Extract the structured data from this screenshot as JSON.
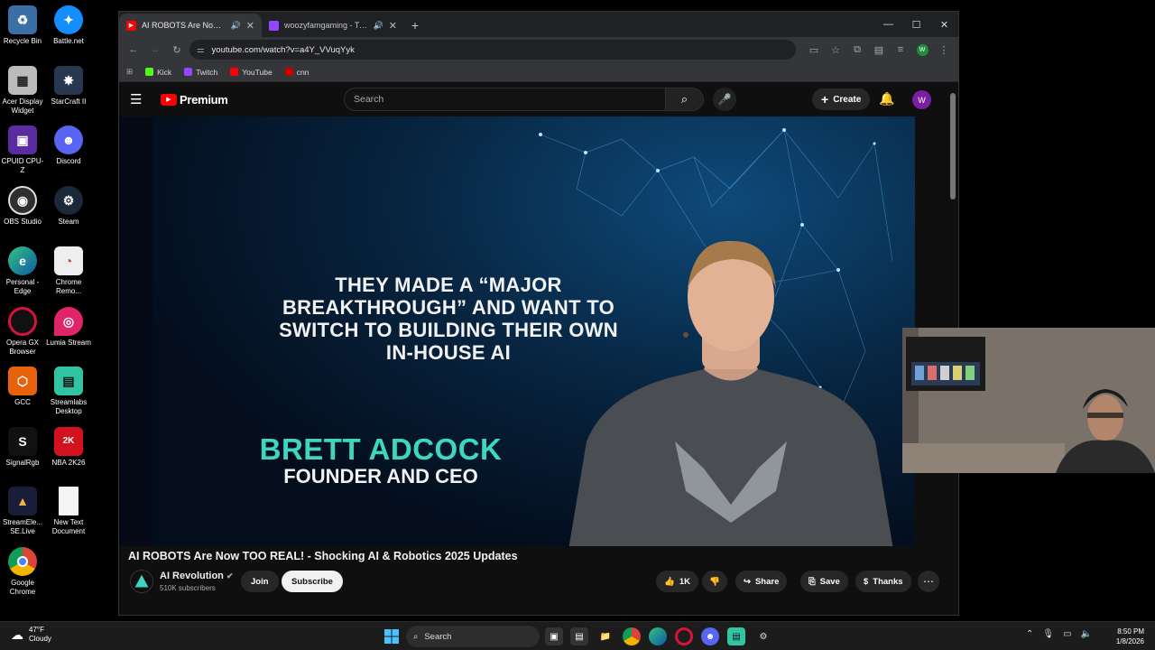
{
  "desktop": {
    "icons": [
      {
        "label": "Recycle Bin"
      },
      {
        "label": "Battle.net"
      },
      {
        "label": "Acer Display Widget"
      },
      {
        "label": "StarCraft II"
      },
      {
        "label": "CPUID CPU-Z"
      },
      {
        "label": "Discord"
      },
      {
        "label": "OBS Studio"
      },
      {
        "label": "Steam"
      },
      {
        "label": "Personal - Edge"
      },
      {
        "label": "Chrome Remo..."
      },
      {
        "label": "Opera GX Browser"
      },
      {
        "label": "Lumia Stream"
      },
      {
        "label": "GCC"
      },
      {
        "label": "Streamlabs Desktop"
      },
      {
        "label": "SignalRgb"
      },
      {
        "label": "NBA 2K26"
      },
      {
        "label": "StreamEle... SE.Live"
      },
      {
        "label": "New Text Document"
      },
      {
        "label": "Google Chrome"
      }
    ]
  },
  "browser": {
    "tabs": [
      {
        "title": "AI ROBOTS Are Now TOO REAL",
        "active": true
      },
      {
        "title": "woozyfamgaming - Twitch",
        "active": false
      }
    ],
    "address": "youtube.com/watch?v=a4Y_VVuqYyk",
    "profile_initial": "W",
    "bookmarks": [
      {
        "label": "Kick",
        "color": "#53fc18"
      },
      {
        "label": "Twitch",
        "color": "#9146ff"
      },
      {
        "label": "YouTube",
        "color": "#ff0000"
      },
      {
        "label": "cnn",
        "color": "#cc0000"
      }
    ]
  },
  "youtube": {
    "logo_text": "Premium",
    "search_placeholder": "Search",
    "create_label": "Create",
    "avatar_initial": "W",
    "video": {
      "headline": "THEY MADE A “MAJOR BREAKTHROUGH” AND WANT TO SWITCH TO BUILDING THEIR OWN IN-HOUSE AI",
      "name": "BRETT ADCOCK",
      "role": "FOUNDER AND CEO"
    },
    "title": "AI ROBOTS Are Now TOO REAL! - Shocking AI & Robotics 2025 Updates",
    "channel": {
      "name": "AI Revolution",
      "subscribers": "510K subscribers",
      "join_label": "Join",
      "subscribe_label": "Subscribe"
    },
    "actions": {
      "likes": "1K",
      "share": "Share",
      "save": "Save",
      "thanks": "Thanks"
    }
  },
  "taskbar": {
    "weather_temp": "47°F",
    "weather_desc": "Cloudy",
    "search_label": "Search",
    "time": "8:50 PM",
    "date": "1/8/2026"
  }
}
